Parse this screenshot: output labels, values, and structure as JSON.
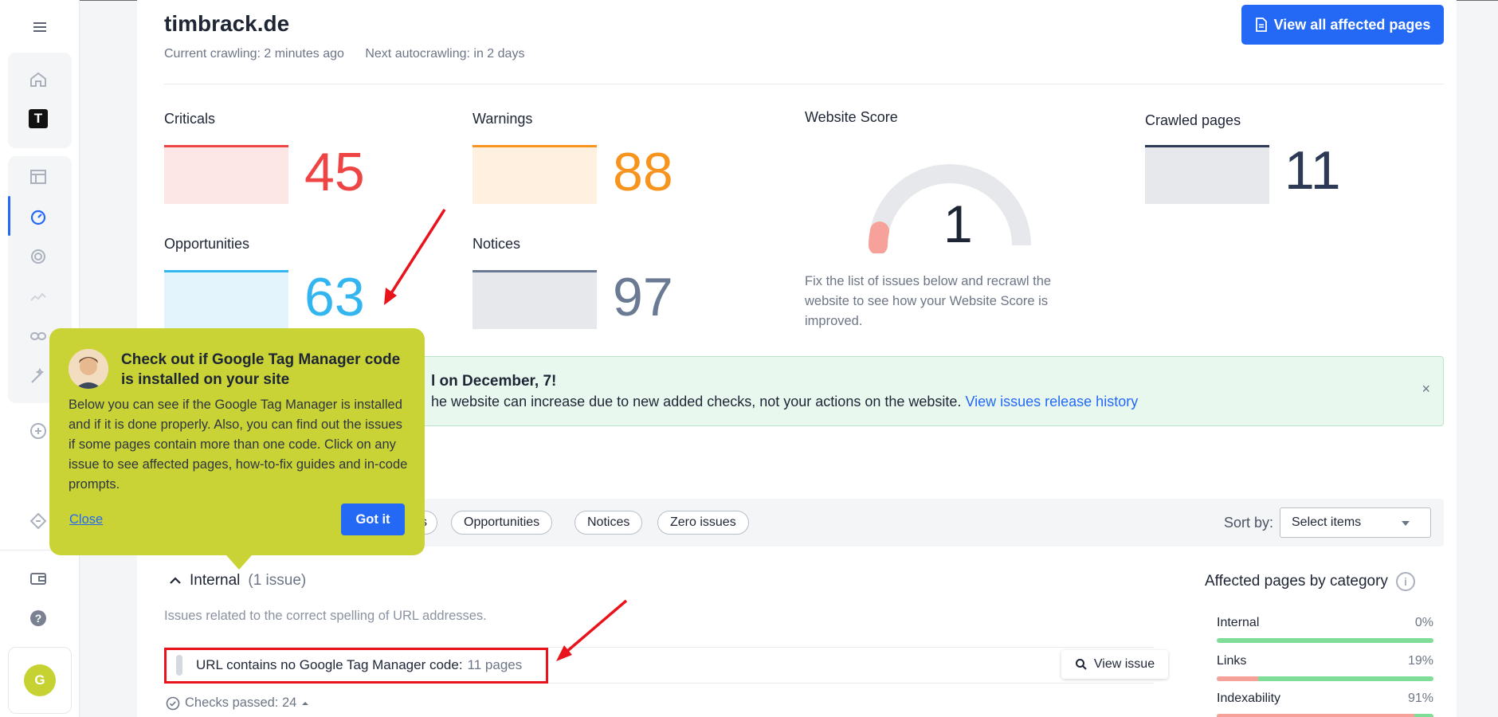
{
  "site": {
    "title": "timbrack.de",
    "current_crawling": "Current crawling: 2 minutes ago",
    "next_autocrawling": "Next autocrawling: in 2 days",
    "view_all_button": "View all affected pages"
  },
  "metrics": {
    "criticals": {
      "label": "Criticals",
      "value": "45",
      "color": "#ef4444"
    },
    "warnings": {
      "label": "Warnings",
      "value": "88",
      "color": "#f7941d"
    },
    "opportunities": {
      "label": "Opportunities",
      "value": "63",
      "color": "#33b5f0"
    },
    "notices": {
      "label": "Notices",
      "value": "97",
      "color": "#6b7a93"
    },
    "crawled": {
      "label": "Crawled pages",
      "value": "11",
      "color": "#2c3a55"
    }
  },
  "score": {
    "label": "Website Score",
    "value": "1",
    "description": "Fix the list of issues below and recrawl the website to see how your Website Score is improved."
  },
  "banner": {
    "title": "l on December, 7!",
    "text": "he website can increase due to new added checks, not your actions on the website.",
    "link": "View issues release history",
    "close": "×"
  },
  "filters": {
    "chips": [
      "s",
      "Opportunities",
      "Notices",
      "Zero issues"
    ],
    "sort_label": "Sort by:",
    "sort_value": "Select items"
  },
  "section": {
    "name": "Internal",
    "count": "(1 issue)",
    "description": "Issues related to the correct spelling of URL addresses.",
    "issue_text": "URL contains no Google Tag Manager code:",
    "issue_pages": "11 pages",
    "view_issue": "View issue",
    "checks_passed": "Checks passed: 24"
  },
  "affected": {
    "title": "Affected pages by category",
    "categories": [
      {
        "name": "Internal",
        "pct": "0%",
        "value": 0
      },
      {
        "name": "Links",
        "pct": "19%",
        "value": 19
      },
      {
        "name": "Indexability",
        "pct": "91%",
        "value": 91
      }
    ]
  },
  "tooltip": {
    "title": "Check out if Google Tag Manager code is installed on your site",
    "body": "Below you can see if the Google Tag Manager is installed and if it is done properly. Also, you can find out the issues if some pages contain more than one code. Click on any issue to see affected pages, how-to-fix guides and in-code prompts.",
    "close": "Close",
    "got_it": "Got it"
  },
  "sidebar": {
    "user_initial": "G",
    "brand_letter": "T"
  }
}
